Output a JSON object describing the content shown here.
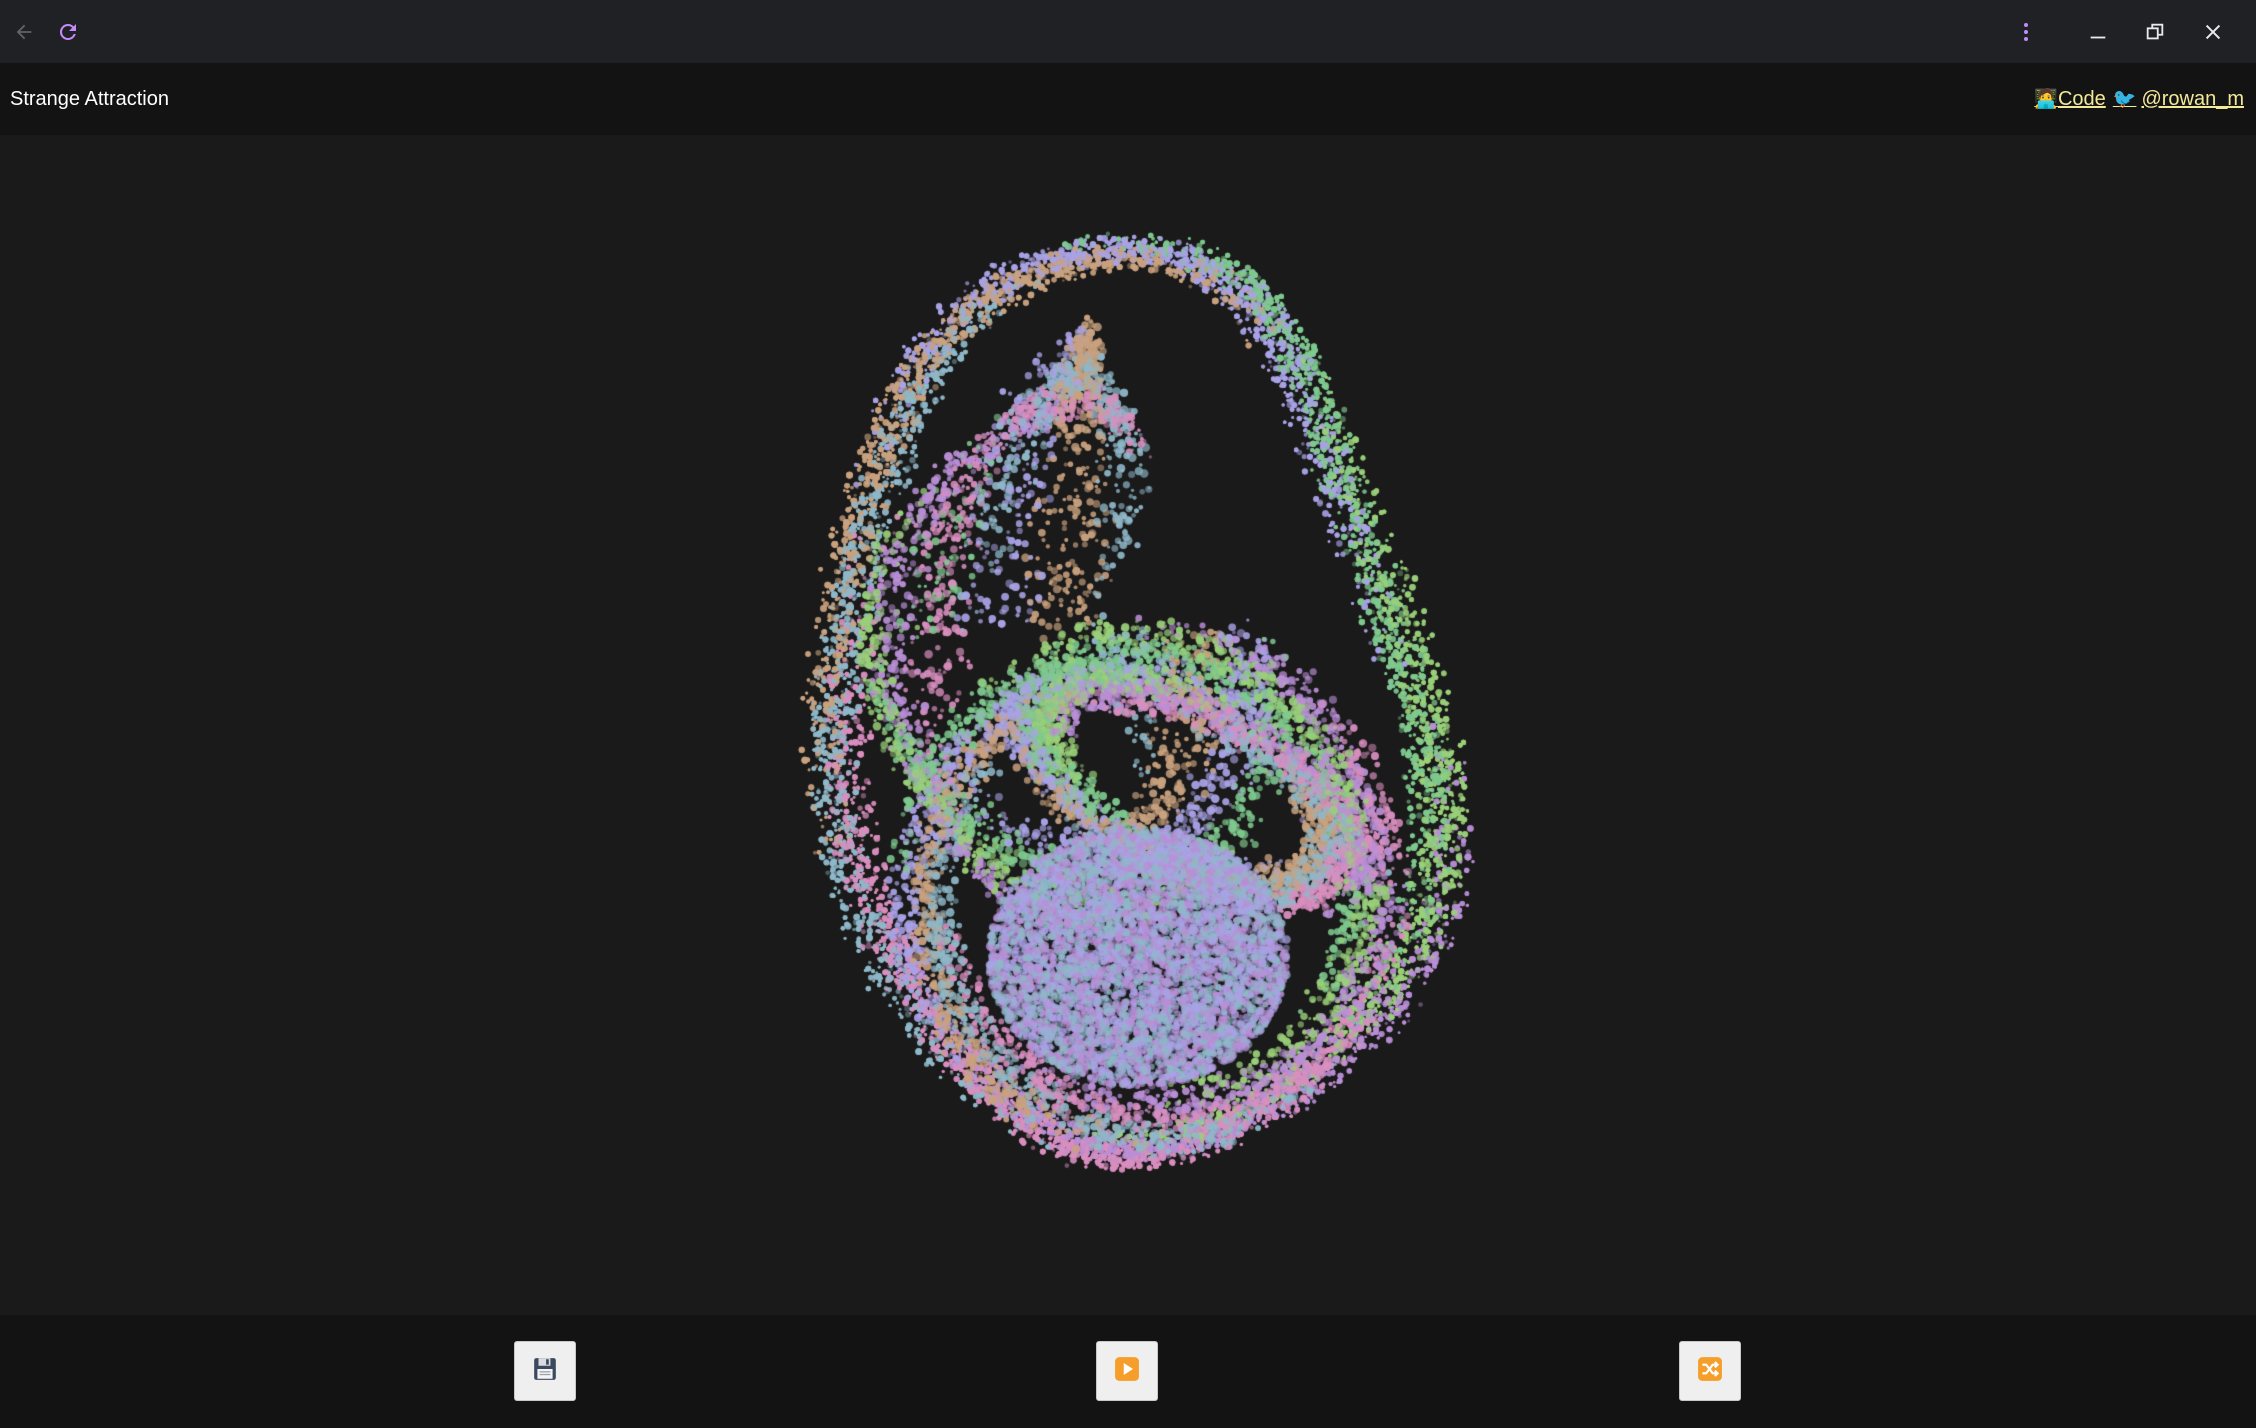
{
  "app": {
    "title": "Strange Attraction"
  },
  "header": {
    "links": [
      {
        "emoji": "🧑‍💻",
        "label": "Code"
      },
      {
        "emoji": "🐦",
        "label": "@rowan_m"
      }
    ]
  },
  "browser": {
    "icons": [
      "back-arrow-icon",
      "reload-icon",
      "more-vert-icon",
      "minimize-icon",
      "restore-icon",
      "close-icon"
    ]
  },
  "controls": [
    {
      "name": "save",
      "icon": "floppy-disk-icon"
    },
    {
      "name": "play",
      "icon": "play-icon"
    },
    {
      "name": "shuffle",
      "icon": "shuffle-icon"
    }
  ],
  "colors": {
    "titlebar": "#202124",
    "header": "#131313",
    "stage": "#1a1a1a",
    "link": "#f2e89a",
    "accent_reload": "#c58af9",
    "play_orange": "#f59e2a",
    "particles": [
      "#7fc98f",
      "#9ad07a",
      "#b98fd6",
      "#d98fbf",
      "#8fb8c9",
      "#c9a27f",
      "#a9a3e6"
    ]
  }
}
